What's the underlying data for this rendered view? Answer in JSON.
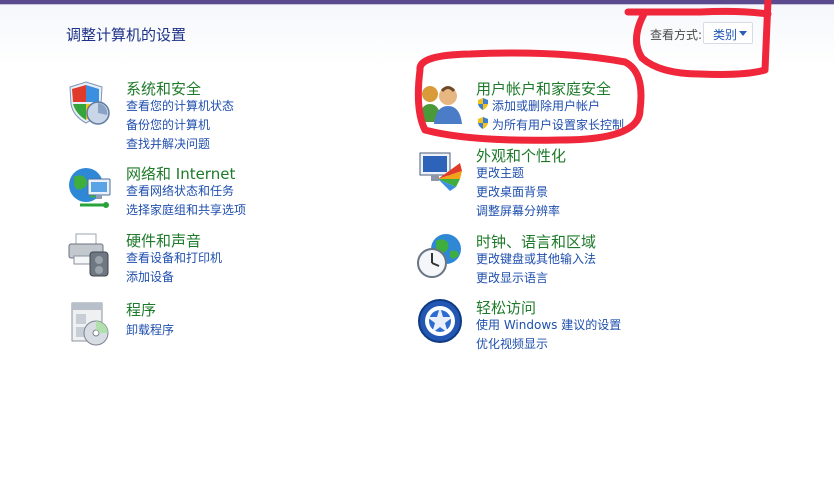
{
  "header": {
    "title": "调整计算机的设置",
    "view_by_label": "查看方式:",
    "view_by_value": "类别"
  },
  "categories": {
    "system": {
      "title": "系统和安全",
      "icon": "shield-flag-icon",
      "links": [
        "查看您的计算机状态",
        "备份您的计算机",
        "查找并解决问题"
      ]
    },
    "network": {
      "title": "网络和 Internet",
      "icon": "globe-network-icon",
      "links": [
        "查看网络状态和任务",
        "选择家庭组和共享选项"
      ]
    },
    "hardware": {
      "title": "硬件和声音",
      "icon": "printer-speaker-icon",
      "links": [
        "查看设备和打印机",
        "添加设备"
      ]
    },
    "programs": {
      "title": "程序",
      "icon": "programs-disc-icon",
      "links": [
        "卸载程序"
      ]
    },
    "users": {
      "title": "用户帐户和家庭安全",
      "icon": "users-icon",
      "links": [
        "添加或删除用户帐户",
        "为所有用户设置家长控制"
      ]
    },
    "appearance": {
      "title": "外观和个性化",
      "icon": "monitor-palette-icon",
      "links": [
        "更改主题",
        "更改桌面背景",
        "调整屏幕分辨率"
      ]
    },
    "clock": {
      "title": "时钟、语言和区域",
      "icon": "clock-globe-icon",
      "links": [
        "更改键盘或其他输入法",
        "更改显示语言"
      ]
    },
    "ease": {
      "title": "轻松访问",
      "icon": "ease-of-access-icon",
      "links": [
        "使用 Windows 建议的设置",
        "优化视频显示"
      ]
    }
  },
  "colors": {
    "category_title": "#1e7a2a",
    "link": "#1f4fae",
    "page_title": "#1e3287",
    "annotation": "#f0263a"
  }
}
